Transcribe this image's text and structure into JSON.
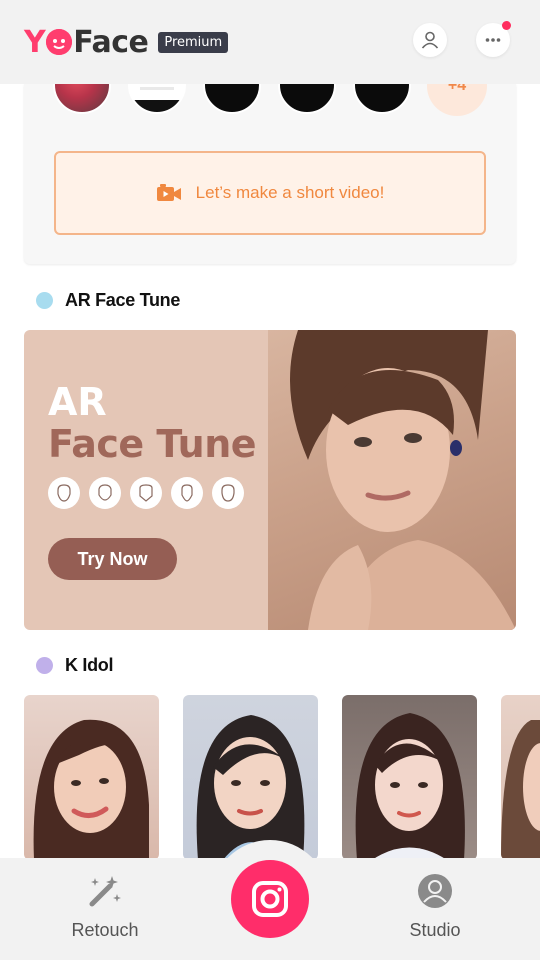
{
  "header": {
    "logo_text_1": "Y",
    "logo_text_2": "Face",
    "premium_badge": "Premium"
  },
  "top_card": {
    "more_count": "+4",
    "video_button_label": "Let’s make a short video!"
  },
  "sections": {
    "ar_face_tune": {
      "title": "AR Face Tune",
      "dot_color": "#a8dcef"
    },
    "k_idol": {
      "title": "K Idol",
      "dot_color": "#c0b0ea"
    }
  },
  "banner": {
    "title_line_1": "AR",
    "title_line_2": "Face Tune",
    "button_label": "Try Now"
  },
  "bottom_nav": {
    "retouch_label": "Retouch",
    "studio_label": "Studio"
  },
  "colors": {
    "brand_pink": "#ff2d6a",
    "accent_orange": "#f0883f",
    "banner_brown": "#955e54"
  }
}
